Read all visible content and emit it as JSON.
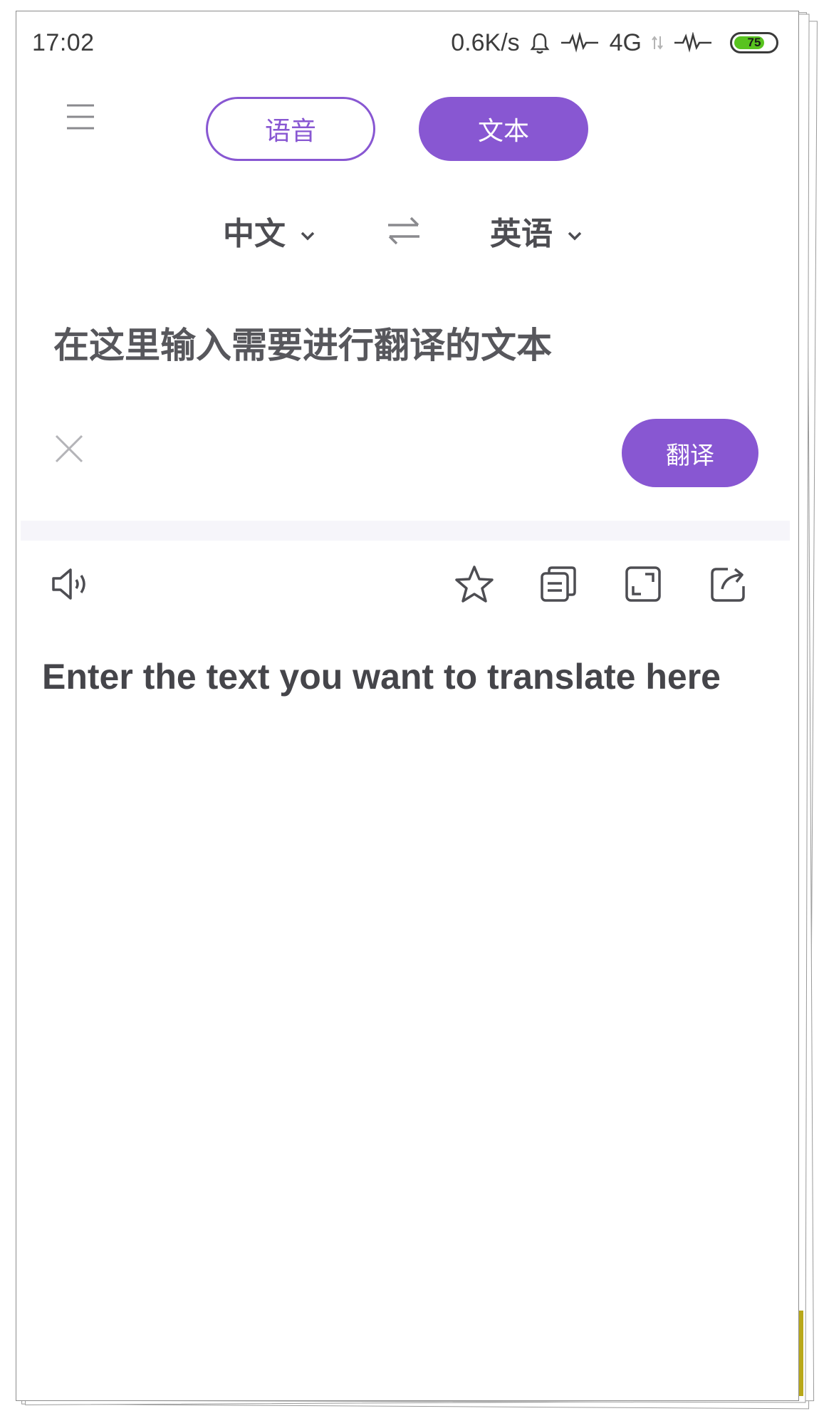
{
  "status_bar": {
    "time": "17:02",
    "network_speed": "0.6K/s",
    "network_type": "4G",
    "battery_level": "75",
    "battery_fraction": 0.75,
    "battery_color": "#58c31f"
  },
  "header": {
    "menu_icon": "hamburger-menu-icon",
    "modes": [
      {
        "label": "语音",
        "active": false
      },
      {
        "label": "文本",
        "active": true
      }
    ],
    "accent_color": "#8857d2"
  },
  "language": {
    "source": "中文",
    "target": "英语",
    "swap_icon": "swap-arrows-icon"
  },
  "input": {
    "placeholder": "在这里输入需要进行翻译的文本",
    "value": "",
    "clear_icon": "close-icon",
    "translate_label": "翻译"
  },
  "result": {
    "toolbar_icons": [
      "speaker-icon",
      "star-icon",
      "copy-icon",
      "fullscreen-icon",
      "share-icon"
    ],
    "text": "Enter the text you want to translate here"
  }
}
